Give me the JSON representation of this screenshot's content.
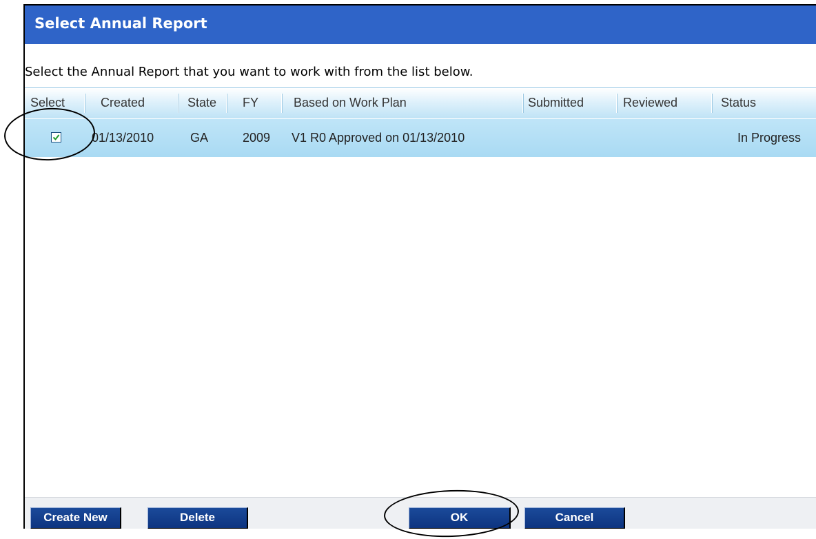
{
  "dialog": {
    "title": "Select Annual Report",
    "instructions": "Select the Annual Report that you want to work with from the list below."
  },
  "grid": {
    "columns": [
      "Select",
      "Created",
      "State",
      "FY",
      "Based on Work Plan",
      "Submitted",
      "Reviewed",
      "Status"
    ],
    "rows": [
      {
        "selected": true,
        "created": "01/13/2010",
        "state": "GA",
        "fy": "2009",
        "based_on_work_plan": "V1 R0 Approved on 01/13/2010",
        "submitted": "",
        "reviewed": "",
        "status": "In Progress"
      }
    ]
  },
  "buttons": {
    "create_new": "Create New",
    "delete": "Delete",
    "ok": "OK",
    "cancel": "Cancel"
  },
  "colors": {
    "title_bar": "#2f64c8",
    "selected_row": "#b5e0f5",
    "button": "#0d3480"
  },
  "icons": {
    "checkbox_check": "checkmark-icon"
  }
}
